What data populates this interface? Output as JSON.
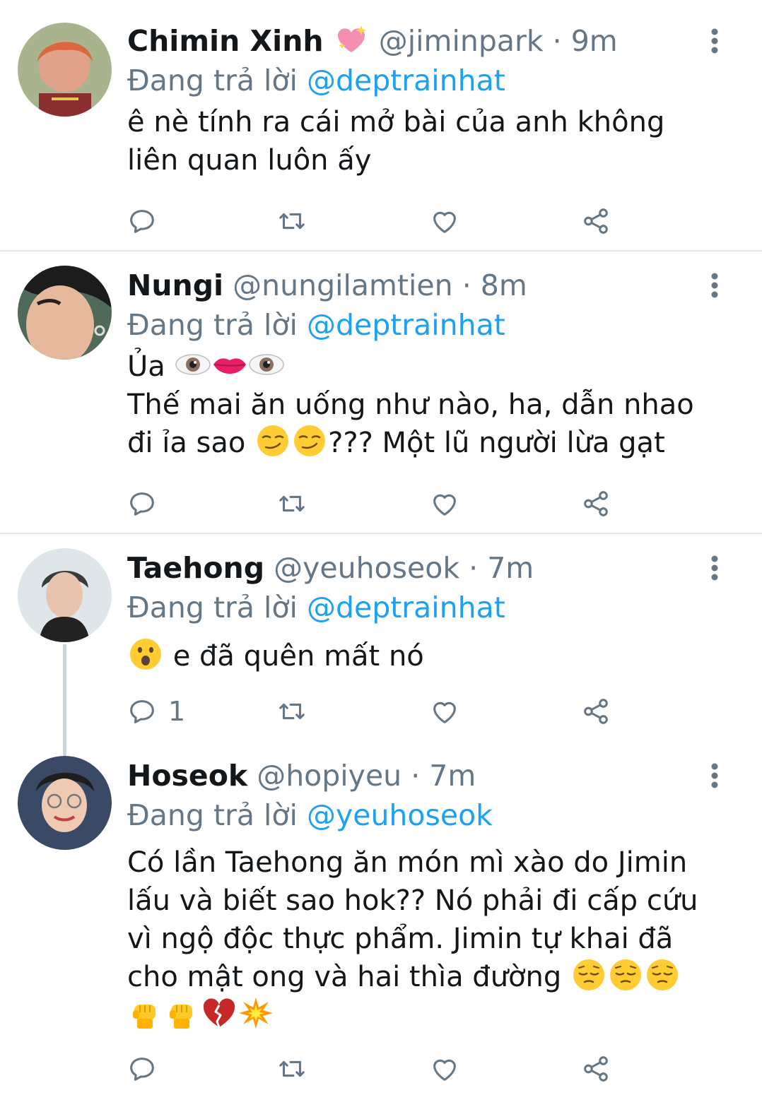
{
  "reply_prefix": "Đang trả lời",
  "tweets": [
    {
      "name": "Chimin Xinh",
      "name_emoji": "sparkling-heart",
      "handle": "@jiminpark",
      "separator": "·",
      "time": "9m",
      "replying_to": "@deptrainhat",
      "lines": [
        "ê nè tính ra cái mở bài của anh không",
        "liên quan luôn ấy"
      ],
      "reply_count": ""
    },
    {
      "name": "Nungi",
      "handle": "@nungilamtien",
      "separator": "·",
      "time": "8m",
      "replying_to": "@deptrainhat",
      "lines": [
        "Ủa",
        "Thế mai ăn uống như nào, ha, dẫn nhao",
        "đi ỉa sao",
        "??? Một lũ người lừa gạt"
      ],
      "emojis": [
        "eye",
        "mouth",
        "eye",
        "smirk",
        "smirk"
      ],
      "reply_count": ""
    },
    {
      "name": "Taehong",
      "handle": "@yeuhoseok",
      "separator": "·",
      "time": "7m",
      "replying_to": "@deptrainhat",
      "lines": [
        "e đã quên mất nó"
      ],
      "emojis": [
        "hushed-face"
      ],
      "reply_count": "1"
    },
    {
      "name": "Hoseok",
      "handle": "@hopiyeu",
      "separator": "·",
      "time": "7m",
      "replying_to": "@yeuhoseok",
      "lines": [
        "Có lần Taehong ăn món mì xào do Jimin",
        "lấu và biết sao hok?? Nó phải đi cấp cứu",
        "vì ngộ độc thực phẩm. Jimin tự khai đã",
        "cho mật ong và hai thìa đường"
      ],
      "emojis": [
        "pensive",
        "pensive",
        "pensive",
        "raised-fist",
        "raised-fist",
        "broken-heart",
        "collision"
      ],
      "reply_count": ""
    }
  ],
  "icons": [
    "reply-icon",
    "retweet-icon",
    "like-icon",
    "share-icon",
    "more-icon"
  ],
  "colors": {
    "link": "#1da1f2",
    "muted": "#657786",
    "text": "#14171a",
    "divider": "#e1e8ed"
  }
}
